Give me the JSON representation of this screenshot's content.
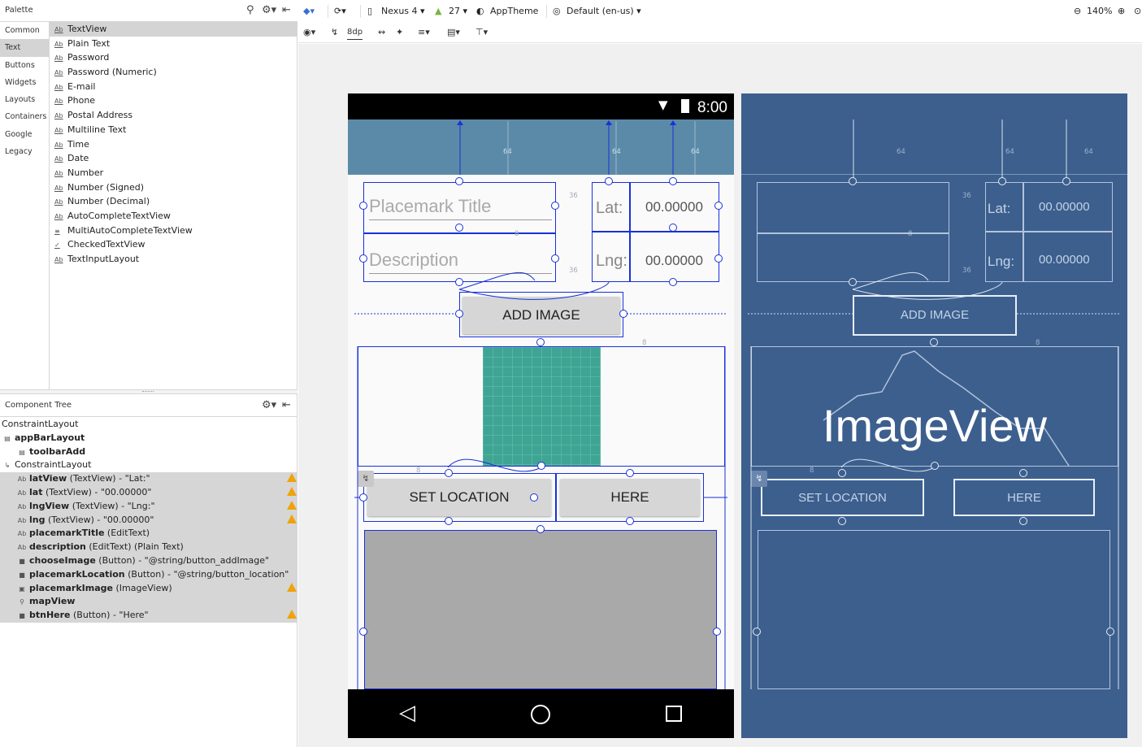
{
  "palette": {
    "title": "Palette",
    "categories": [
      "Common",
      "Text",
      "Buttons",
      "Widgets",
      "Layouts",
      "Containers",
      "Google",
      "Legacy"
    ],
    "selected_category": "Text",
    "items": [
      {
        "icon": "Ab",
        "label": "TextView"
      },
      {
        "icon": "Ab",
        "label": "Plain Text"
      },
      {
        "icon": "Ab",
        "label": "Password"
      },
      {
        "icon": "Ab",
        "label": "Password (Numeric)"
      },
      {
        "icon": "Ab",
        "label": "E-mail"
      },
      {
        "icon": "Ab",
        "label": "Phone"
      },
      {
        "icon": "Ab",
        "label": "Postal Address"
      },
      {
        "icon": "Ab",
        "label": "Multiline Text"
      },
      {
        "icon": "Ab",
        "label": "Time"
      },
      {
        "icon": "Ab",
        "label": "Date"
      },
      {
        "icon": "Ab",
        "label": "Number"
      },
      {
        "icon": "Ab",
        "label": "Number (Signed)"
      },
      {
        "icon": "Ab",
        "label": "Number (Decimal)"
      },
      {
        "icon": "Ab",
        "label": "AutoCompleteTextView"
      },
      {
        "icon": "≡",
        "label": "MultiAutoCompleteTextView"
      },
      {
        "icon": "✓",
        "label": "CheckedTextView"
      },
      {
        "icon": "Ab",
        "label": "TextInputLayout"
      }
    ]
  },
  "component_tree": {
    "title": "Component Tree",
    "rows": [
      {
        "indent": 0,
        "icon": "",
        "name": "ConstraintLayout",
        "detail": "",
        "bold": false,
        "sel": false,
        "warn": false
      },
      {
        "indent": 0,
        "icon": "▤",
        "name": "appBarLayout",
        "detail": "",
        "bold": true,
        "sel": false,
        "warn": false
      },
      {
        "indent": 1,
        "icon": "▤",
        "name": "toolbarAdd",
        "detail": "",
        "bold": true,
        "sel": false,
        "warn": false
      },
      {
        "indent": 0,
        "icon": "↳",
        "name": "ConstraintLayout",
        "detail": "",
        "bold": false,
        "sel": false,
        "warn": false
      },
      {
        "indent": 1,
        "icon": "Ab",
        "name": "latView",
        "detail": " (TextView) - \"Lat:\"",
        "bold": true,
        "sel": true,
        "warn": true
      },
      {
        "indent": 1,
        "icon": "Ab",
        "name": "lat",
        "detail": " (TextView) - \"00.00000\"",
        "bold": true,
        "sel": true,
        "warn": true
      },
      {
        "indent": 1,
        "icon": "Ab",
        "name": "lngView",
        "detail": " (TextView) - \"Lng:\"",
        "bold": true,
        "sel": true,
        "warn": true
      },
      {
        "indent": 1,
        "icon": "Ab",
        "name": "lng",
        "detail": " (TextView) - \"00.00000\"",
        "bold": true,
        "sel": true,
        "warn": true
      },
      {
        "indent": 1,
        "icon": "Ab",
        "name": "placemarkTitle",
        "detail": " (EditText)",
        "bold": true,
        "sel": true,
        "warn": false
      },
      {
        "indent": 1,
        "icon": "Ab",
        "name": "description",
        "detail": " (EditText) (Plain Text)",
        "bold": true,
        "sel": true,
        "warn": false
      },
      {
        "indent": 1,
        "icon": "■",
        "name": "chooseImage",
        "detail": " (Button) - \"@string/button_addImage\"",
        "bold": true,
        "sel": true,
        "warn": false
      },
      {
        "indent": 1,
        "icon": "■",
        "name": "placemarkLocation",
        "detail": " (Button) - \"@string/button_location\"",
        "bold": true,
        "sel": true,
        "warn": false
      },
      {
        "indent": 1,
        "icon": "▣",
        "name": "placemarkImage",
        "detail": " (ImageView)",
        "bold": true,
        "sel": true,
        "warn": true
      },
      {
        "indent": 1,
        "icon": "⚲",
        "name": "mapView",
        "detail": "",
        "bold": true,
        "sel": true,
        "warn": false
      },
      {
        "indent": 1,
        "icon": "■",
        "name": "btnHere",
        "detail": " (Button) - \"Here\"",
        "bold": true,
        "sel": true,
        "warn": true
      }
    ]
  },
  "toolbar": {
    "device": "Nexus 4",
    "api": "27",
    "theme": "AppTheme",
    "locale": "Default (en-us)",
    "zoom": "140%",
    "margin": "8dp"
  },
  "phone": {
    "time": "8:00",
    "placemark_title_hint": "Placemark Title",
    "description_hint": "Description",
    "lat_label": "Lat:",
    "lat_value": "00.00000",
    "lng_label": "Lng:",
    "lng_value": "00.00000",
    "add_image": "ADD IMAGE",
    "set_location": "SET LOCATION",
    "here": "HERE",
    "dim_64": "64",
    "dim_36": "36",
    "dim_8": "8"
  },
  "blueprint": {
    "add_image": "ADD IMAGE",
    "image_view": "ImageView",
    "set_location": "SET LOCATION",
    "here": "HERE",
    "lat_label": "Lat:",
    "lat_value": "00.00000",
    "lng_label": "Lng:",
    "lng_value": "00.00000",
    "dim_64": "64",
    "dim_36": "36",
    "dim_8": "8"
  },
  "colors": {
    "selection": "#1a30d8",
    "appbar": "#5b8aa8",
    "blueprint": "#3c5f8e",
    "image_placeholder": "#3ea594",
    "map_placeholder": "#a9a9a9",
    "warning": "#f0a20a"
  }
}
